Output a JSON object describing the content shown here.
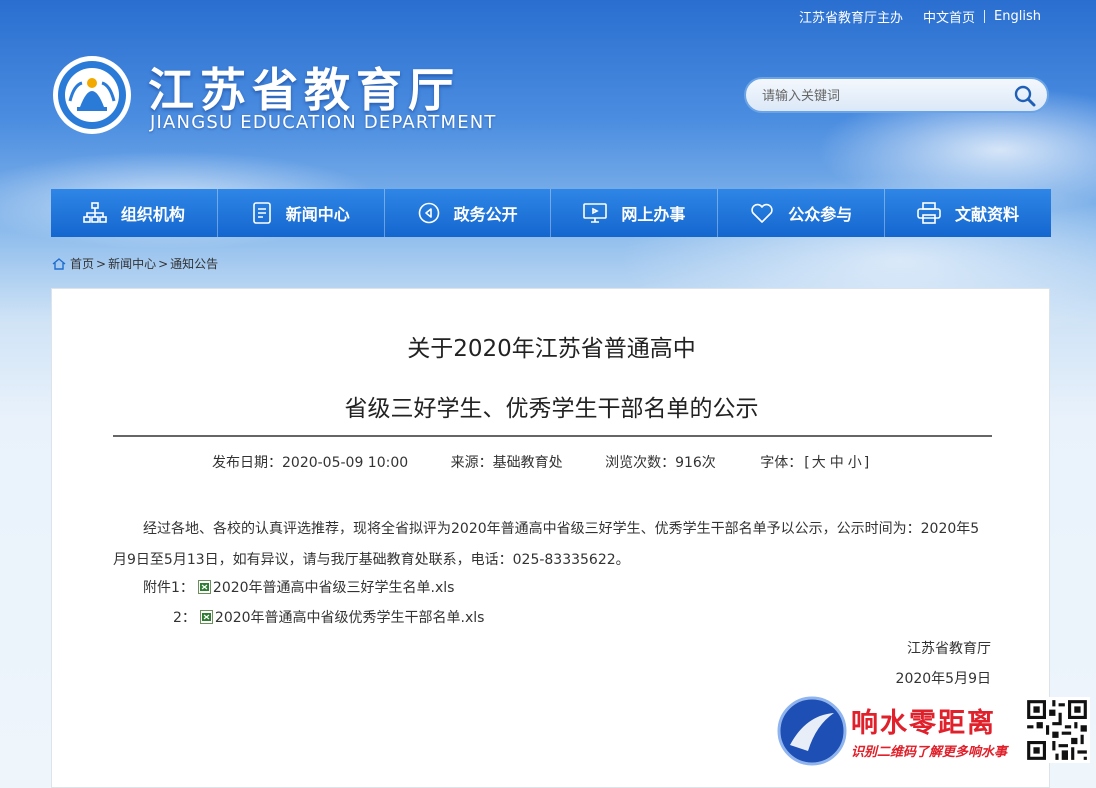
{
  "top_links": {
    "host": "江苏省教育厅主办",
    "cn_home": "中文首页",
    "english": "English"
  },
  "site": {
    "title": "江苏省教育厅",
    "subtitle": "JIANGSU EDUCATION DEPARTMENT"
  },
  "search": {
    "placeholder": "请输入关键词"
  },
  "nav": [
    {
      "label": "组织机构",
      "icon": "org-chart-icon"
    },
    {
      "label": "新闻中心",
      "icon": "document-icon"
    },
    {
      "label": "政务公开",
      "icon": "play-circle-icon"
    },
    {
      "label": "网上办事",
      "icon": "monitor-icon"
    },
    {
      "label": "公众参与",
      "icon": "heart-icon"
    },
    {
      "label": "文献资料",
      "icon": "printer-icon"
    }
  ],
  "breadcrumb": {
    "items": [
      "首页",
      "新闻中心",
      "通知公告"
    ],
    "separator": ">"
  },
  "article": {
    "title_line1": "关于2020年江苏省普通高中",
    "title_line2": "省级三好学生、优秀学生干部名单的公示",
    "publish_date": "发布日期：2020-05-09 10:00",
    "source": "来源：基础教育处",
    "views": "浏览次数：916次",
    "font_size_label": "字体：",
    "font_sizes": [
      "大",
      "中",
      "小"
    ],
    "body": "经过各地、各校的认真评选推荐，现将全省拟评为2020年普通高中省级三好学生、优秀学生干部名单予以公示，公示时间为：2020年5月9日至5月13日，如有异议，请与我厅基础教育处联系，电话：025-83335622。",
    "attachment1_label": "附件1：",
    "attachment1_file": "2020年普通高中省级三好学生名单.xls",
    "attachment2_label": "2：",
    "attachment2_file": "2020年普通高中省级优秀学生干部名单.xls",
    "signature_org": "江苏省教育厅",
    "signature_date": "2020年5月9日"
  },
  "watermark": {
    "title": "响水零距离",
    "subtitle": "识别二维码了解更多响水事"
  },
  "colors": {
    "nav_blue": "#1a6fd6",
    "watermark_red": "#e0202a"
  }
}
